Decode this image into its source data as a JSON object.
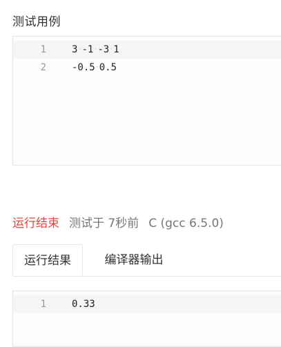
{
  "test_case": {
    "title": "测试用例",
    "lines": [
      {
        "num": "1",
        "tokens": [
          "3",
          "-1",
          "-3",
          "1"
        ]
      },
      {
        "num": "2",
        "tokens": [
          "-0.5",
          "0.5"
        ]
      }
    ]
  },
  "status": {
    "result": "运行结束",
    "tested": "测试于 7秒前",
    "compiler": "C (gcc 6.5.0)"
  },
  "tabs": [
    {
      "label": "运行结果"
    },
    {
      "label": "编译器输出"
    }
  ],
  "output": {
    "lines": [
      {
        "num": "1",
        "text": "0.33"
      }
    ]
  },
  "colors": {
    "status_done": "#e0463a",
    "whitespace_dot": "#c8c8c8"
  }
}
